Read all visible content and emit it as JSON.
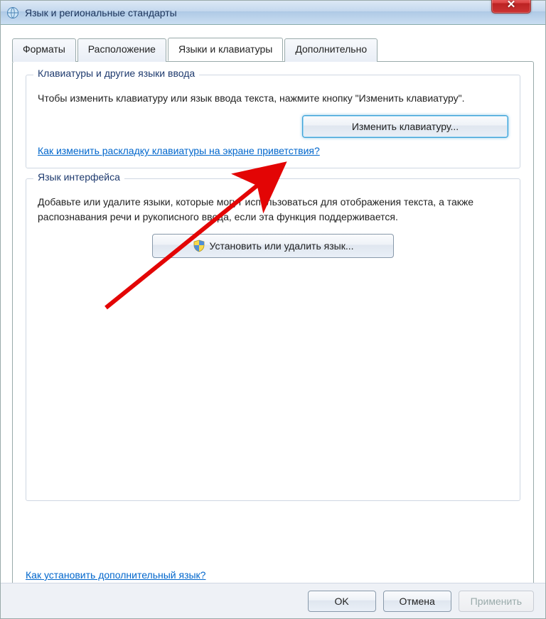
{
  "window": {
    "title": "Язык и региональные стандарты"
  },
  "tabs": {
    "formats": "Форматы",
    "location": "Расположение",
    "keyboards": "Языки и клавиатуры",
    "advanced": "Дополнительно"
  },
  "group_keyboards": {
    "legend": "Клавиатуры и другие языки ввода",
    "text": "Чтобы изменить клавиатуру или язык ввода текста, нажмите кнопку \"Изменить клавиатуру\".",
    "button": "Изменить клавиатуру...",
    "link": "Как изменить раскладку клавиатуры на экране приветствия?"
  },
  "group_interface": {
    "legend": "Язык интерфейса",
    "text": "Добавьте или удалите языки, которые могут использоваться для отображения текста, а также распознавания речи и рукописного ввода, если эта функция поддерживается.",
    "button": "Установить или удалить язык..."
  },
  "bottom_link": "Как установить дополнительный язык?",
  "footer": {
    "ok": "OK",
    "cancel": "Отмена",
    "apply": "Применить"
  }
}
